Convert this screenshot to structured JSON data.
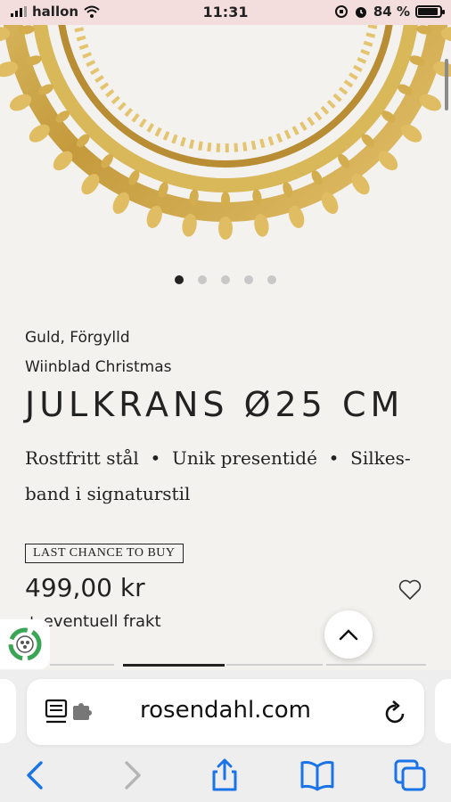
{
  "status_bar": {
    "carrier": "hallon",
    "time": "11:31",
    "battery_percent": "84 %",
    "battery_level": 0.84
  },
  "carousel": {
    "slide_count": 5,
    "active_index": 0
  },
  "product": {
    "variant": "Guld, Förgylld",
    "collection": "Wiinblad Christmas",
    "title": "JULKRANS Ø25 CM",
    "features_line1": "Rostfritt stål  •  Unik presentidé  •  Silkes-",
    "features_line2": "band i signaturstil",
    "badge": "LAST CHANCE TO BUY",
    "price": "499,00 kr",
    "shipping_note": "+ eventuell frakt"
  },
  "browser": {
    "url": "rosendahl.com"
  },
  "colors": {
    "status_bar_bg": "#f4dedd",
    "page_bg": "#f3f2ef",
    "ios_blue": "#1a73e8",
    "gold": "#c9a247"
  },
  "icons": [
    "wifi-icon",
    "alarm-icon",
    "orientation-lock-icon",
    "battery-icon",
    "heart-icon",
    "chevron-up-icon",
    "recycle-icon",
    "reader-mode-icon",
    "extension-icon",
    "reload-icon",
    "back-icon",
    "forward-icon",
    "share-icon",
    "bookmarks-icon",
    "tabs-icon"
  ]
}
